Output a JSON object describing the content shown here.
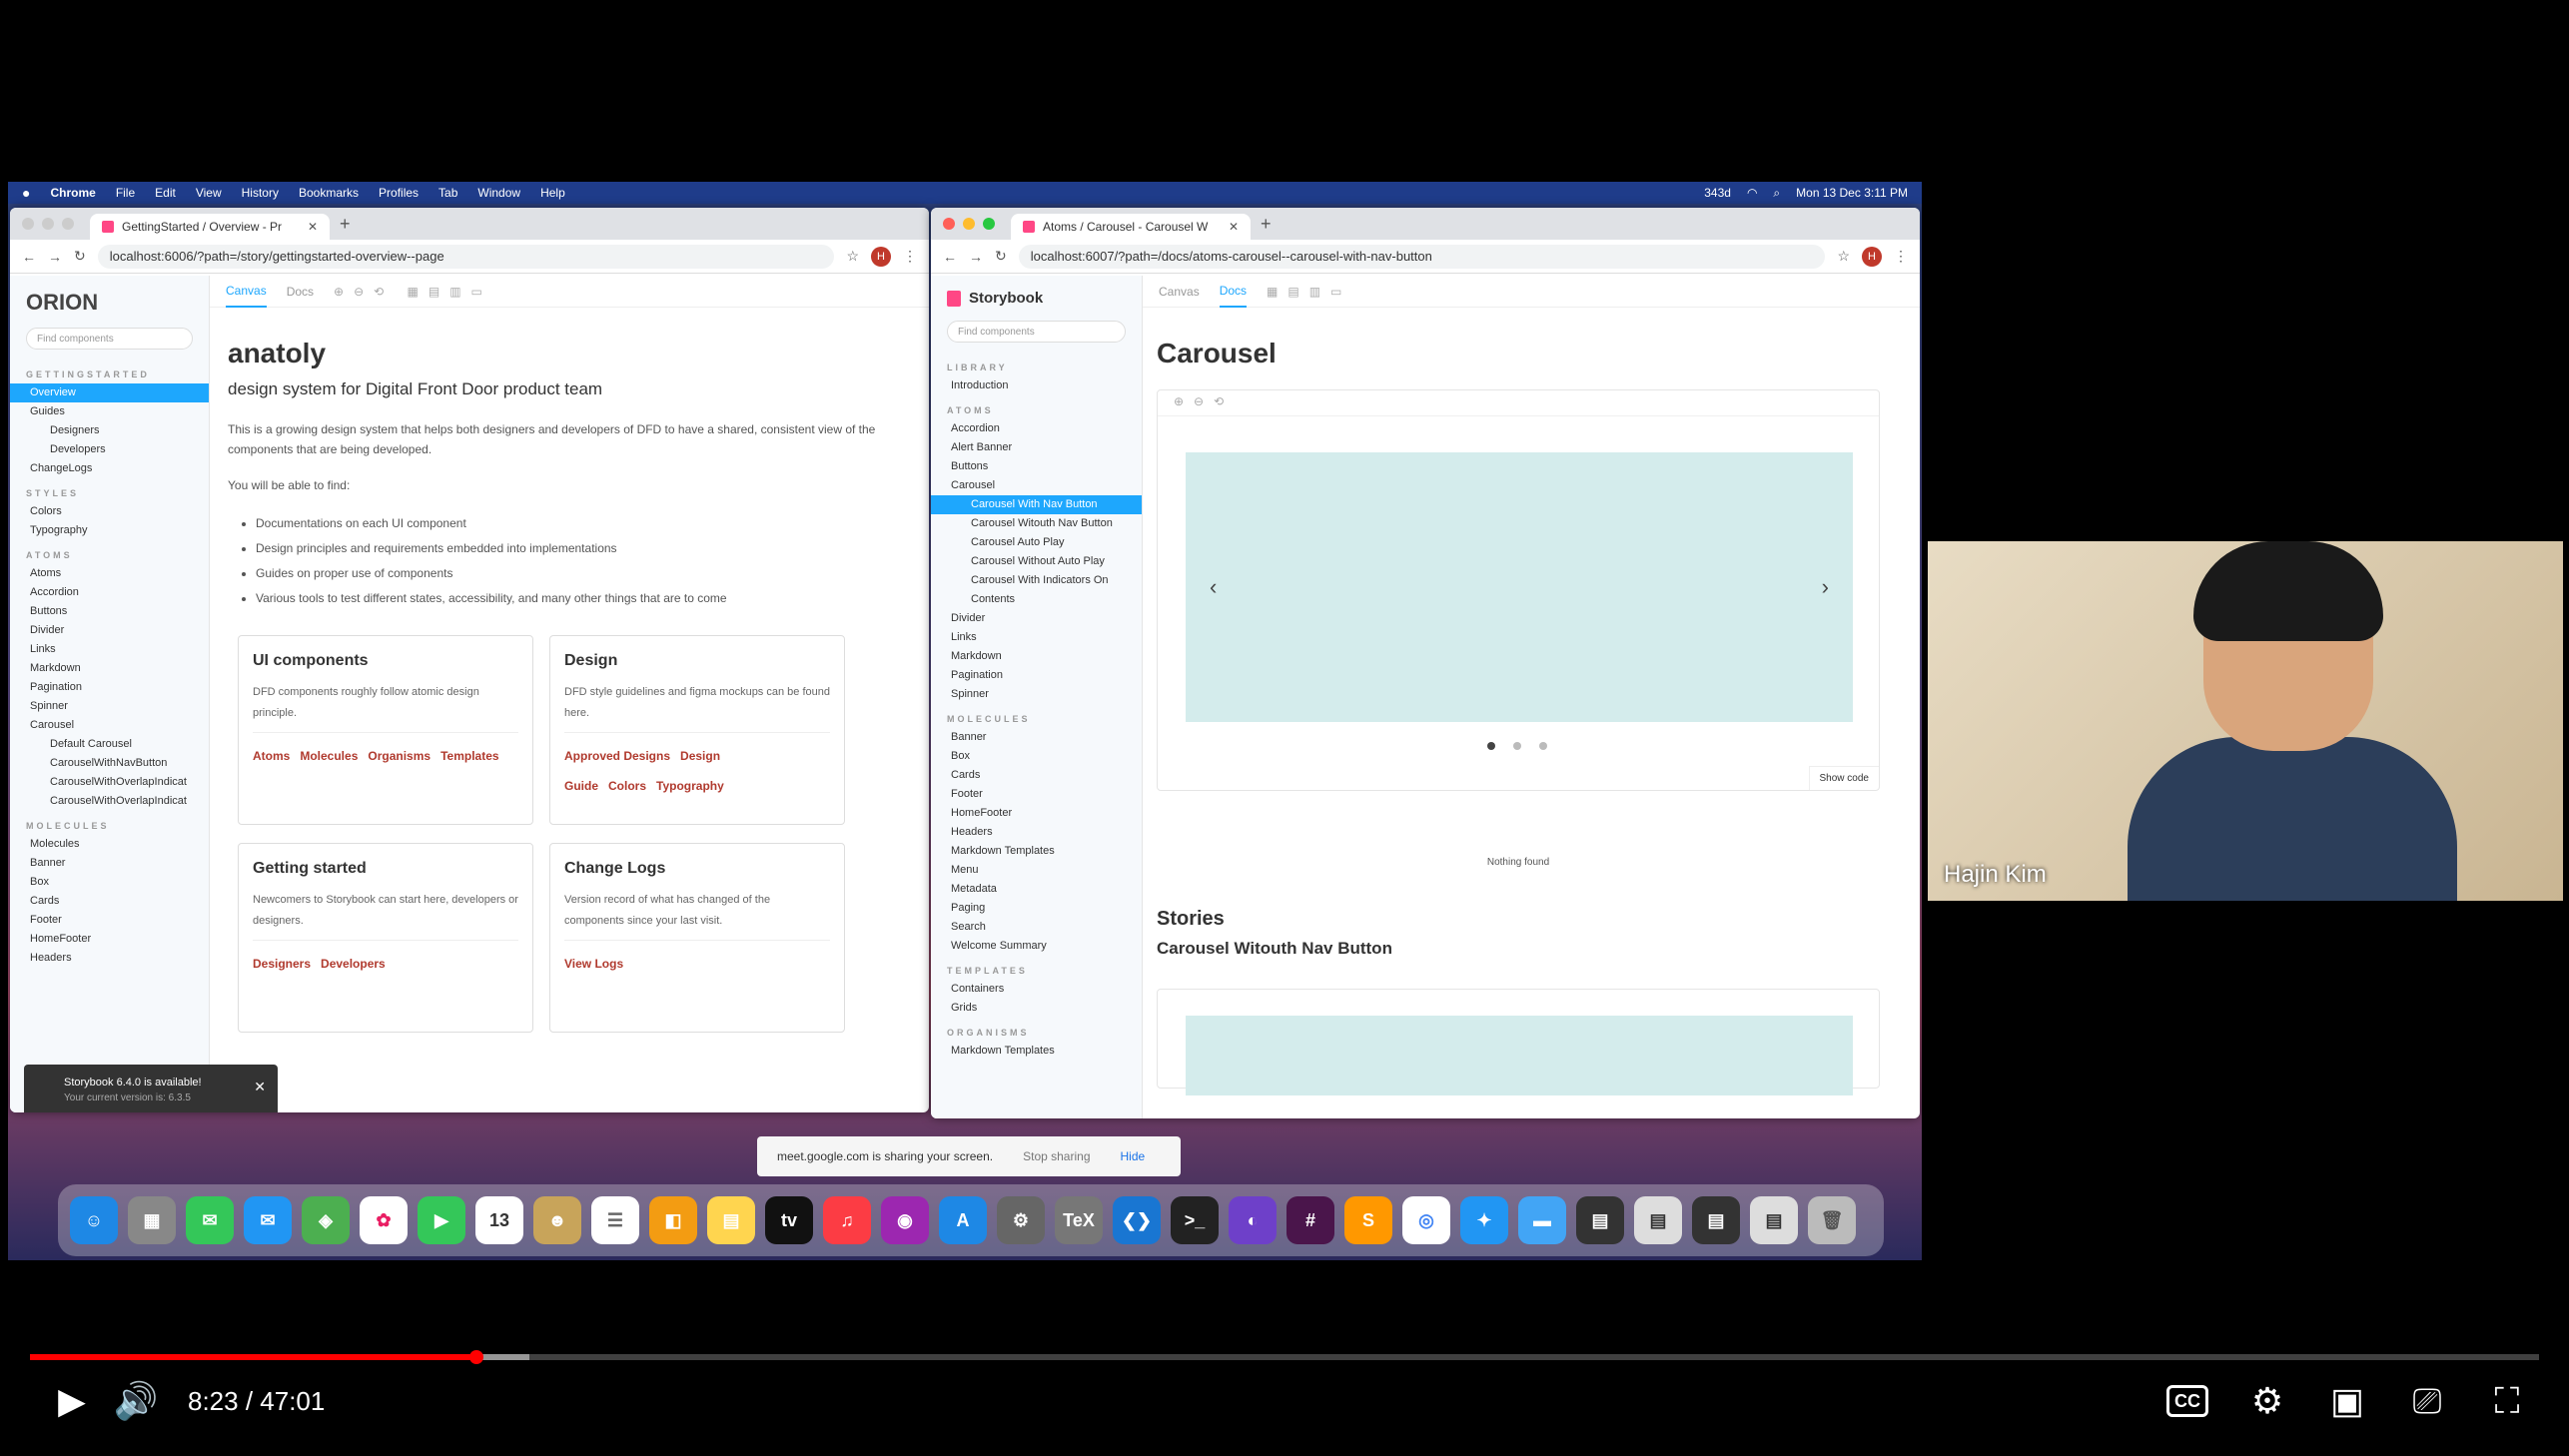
{
  "menubar": {
    "app": "Chrome",
    "items": [
      "File",
      "Edit",
      "View",
      "History",
      "Bookmarks",
      "Profiles",
      "Tab",
      "Window",
      "Help"
    ],
    "clock": "Mon 13 Dec 3:11 PM",
    "battery": "343d"
  },
  "win1": {
    "tab": "GettingStarted / Overview - Pr",
    "url": "localhost:6006/?path=/story/gettingstarted-overview--page",
    "logo": "ORION",
    "find": "Find components",
    "sections": [
      {
        "title": "GETTINGSTARTED",
        "items": [
          {
            "l": "Overview",
            "sel": true
          },
          {
            "l": "Guides"
          },
          {
            "l": "Designers",
            "sub": true
          },
          {
            "l": "Developers",
            "sub": true
          },
          {
            "l": "ChangeLogs"
          }
        ]
      },
      {
        "title": "STYLES",
        "items": [
          {
            "l": "Colors"
          },
          {
            "l": "Typography"
          }
        ]
      },
      {
        "title": "ATOMS",
        "items": [
          {
            "l": "Atoms"
          },
          {
            "l": "Accordion"
          },
          {
            "l": "Buttons"
          },
          {
            "l": "Divider"
          },
          {
            "l": "Links"
          },
          {
            "l": "Markdown"
          },
          {
            "l": "Pagination"
          },
          {
            "l": "Spinner"
          },
          {
            "l": "Carousel"
          },
          {
            "l": "Default Carousel",
            "sub": true
          },
          {
            "l": "CarouselWithNavButton",
            "sub": true
          },
          {
            "l": "CarouselWithOverlapIndicat",
            "sub": true
          },
          {
            "l": "CarouselWithOverlapIndicat",
            "sub": true
          }
        ]
      },
      {
        "title": "MOLECULES",
        "items": [
          {
            "l": "Molecules"
          },
          {
            "l": "Banner"
          },
          {
            "l": "Box"
          },
          {
            "l": "Cards"
          },
          {
            "l": "Footer"
          },
          {
            "l": "HomeFooter"
          },
          {
            "l": "Headers"
          }
        ]
      }
    ],
    "tabs": {
      "canvas": "Canvas",
      "docs": "Docs"
    },
    "title": "anatoly",
    "subtitle": "design system for Digital Front Door product team",
    "intro": "This is a growing design system that helps both designers and developers of DFD to have a shared, consistent view of the components that are being developed.",
    "able": "You will be able to find:",
    "bullets": [
      "Documentations on each UI component",
      "Design principles and requirements embedded into implementations",
      "Guides on proper use of components",
      "Various tools to test different states, accessibility, and many other things that are to come"
    ],
    "cards": [
      {
        "title": "UI components",
        "desc": "DFD components roughly follow atomic design principle.",
        "links": [
          "Atoms",
          "Molecules",
          "Organisms",
          "Templates"
        ]
      },
      {
        "title": "Design",
        "desc": "DFD style guidelines and figma mockups can be found here.",
        "links": [
          "Approved Designs",
          "Design Guide",
          "Colors",
          "Typography"
        ]
      },
      {
        "title": "Getting started",
        "desc": "Newcomers to Storybook can start here, developers or designers.",
        "links": [
          "Designers",
          "Developers"
        ]
      },
      {
        "title": "Change Logs",
        "desc": "Version record of what has changed of the components since your last visit.",
        "links": [
          "View Logs"
        ]
      }
    ],
    "toast": {
      "title": "Storybook 6.4.0 is available!",
      "sub": "Your current version is: 6.3.5"
    }
  },
  "win2": {
    "tab": "Atoms / Carousel - Carousel W",
    "url": "localhost:6007/?path=/docs/atoms-carousel--carousel-with-nav-button",
    "brand": "Storybook",
    "find": "Find components",
    "sections": [
      {
        "title": "LIBRARY",
        "items": [
          {
            "l": "Introduction"
          }
        ]
      },
      {
        "title": "ATOMS",
        "items": [
          {
            "l": "Accordion"
          },
          {
            "l": "Alert Banner"
          },
          {
            "l": "Buttons"
          },
          {
            "l": "Carousel"
          },
          {
            "l": "Carousel With Nav Button",
            "sub": true,
            "sel": true
          },
          {
            "l": "Carousel Witouth Nav Button",
            "sub": true
          },
          {
            "l": "Carousel Auto Play",
            "sub": true
          },
          {
            "l": "Carousel Without Auto Play",
            "sub": true
          },
          {
            "l": "Carousel With Indicators On",
            "sub": true
          },
          {
            "l": "Contents",
            "sub": true
          },
          {
            "l": "Divider"
          },
          {
            "l": "Links"
          },
          {
            "l": "Markdown"
          },
          {
            "l": "Pagination"
          },
          {
            "l": "Spinner"
          }
        ]
      },
      {
        "title": "MOLECULES",
        "items": [
          {
            "l": "Banner"
          },
          {
            "l": "Box"
          },
          {
            "l": "Cards"
          },
          {
            "l": "Footer"
          },
          {
            "l": "HomeFooter"
          },
          {
            "l": "Headers"
          },
          {
            "l": "Markdown Templates"
          },
          {
            "l": "Menu"
          },
          {
            "l": "Metadata"
          },
          {
            "l": "Paging"
          },
          {
            "l": "Search"
          },
          {
            "l": "Welcome Summary"
          }
        ]
      },
      {
        "title": "TEMPLATES",
        "items": [
          {
            "l": "Containers"
          },
          {
            "l": "Grids"
          }
        ]
      },
      {
        "title": "ORGANISMS",
        "items": [
          {
            "l": "Markdown Templates"
          }
        ]
      }
    ],
    "tabs": {
      "canvas": "Canvas",
      "docs": "Docs"
    },
    "title": "Carousel",
    "prev": "‹",
    "next": "›",
    "showcode": "Show code",
    "nothing": "Nothing found",
    "stories": "Stories",
    "story": "Carousel Witouth Nav Button"
  },
  "share": {
    "text": "meet.google.com is sharing your screen.",
    "stop": "Stop sharing",
    "hide": "Hide"
  },
  "camera": {
    "name": "Hajin Kim"
  },
  "player": {
    "time": "8:23 / 47:01",
    "cc": "CC",
    "progress": 0.178
  }
}
